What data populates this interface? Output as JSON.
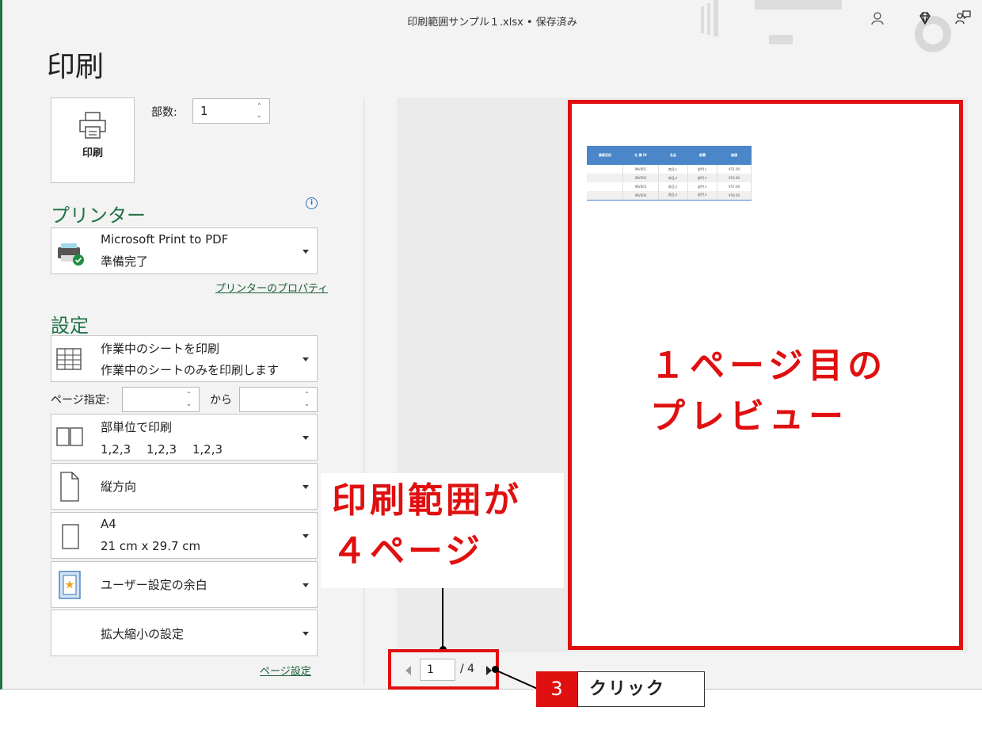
{
  "window": {
    "title": "印刷範囲サンプル１.xlsx • 保存済み"
  },
  "page": {
    "heading": "印刷"
  },
  "print_button": {
    "label": "印刷"
  },
  "copies": {
    "label": "部数:",
    "value": "1"
  },
  "printer": {
    "section_title": "プリンター",
    "name": "Microsoft Print to PDF",
    "status": "準備完了",
    "properties_link": "プリンターのプロパティ"
  },
  "settings": {
    "section_title": "設定",
    "print_what": {
      "title": "作業中のシートを印刷",
      "desc": "作業中のシートのみを印刷します"
    },
    "pages": {
      "label": "ページ指定:",
      "from_value": "",
      "to_label": "から",
      "to_value": ""
    },
    "collate": {
      "title": "部単位で印刷",
      "desc": "1,2,3　 1,2,3　 1,2,3"
    },
    "orientation": {
      "title": "縦方向"
    },
    "paper": {
      "title": "A4",
      "desc": "21 cm x 29.7 cm"
    },
    "margins": {
      "title": "ユーザー設定の余白"
    },
    "scaling": {
      "title": "拡大縮小の設定"
    },
    "page_setup_link": "ページ設定"
  },
  "preview": {
    "table": {
      "headers": [
        "貴期活用",
        "仕 業 ID",
        "名品",
        "部署",
        "価値"
      ],
      "rows": [
        [
          "",
          "INV001",
          "商品１",
          "部門１",
          "¥51.00"
        ],
        [
          "",
          "INV002",
          "商品２",
          "部門２",
          "¥53.00"
        ],
        [
          "",
          "INV003",
          "商品３",
          "部門３",
          "¥57.00"
        ],
        [
          "",
          "INV004",
          "商品４",
          "部門４",
          "¥59.00"
        ]
      ]
    }
  },
  "pager": {
    "current": "1",
    "total": "/ 4"
  },
  "annotations": {
    "preview_caption": "１ページ目の\nプレビュー",
    "range_caption": "印刷範囲が\n４ページ",
    "step_number": "3",
    "step_text": "クリック",
    "accent_color": "#e01010"
  },
  "icons": {
    "printer": "printer-icon",
    "info": "info-icon",
    "pdf_printer": "pdf-printer-icon",
    "sheet": "sheet-grid-icon",
    "collate": "collate-icon",
    "portrait": "portrait-page-icon",
    "paper": "paper-size-icon",
    "margins": "custom-margins-icon",
    "account": "person-icon",
    "premium": "diamond-icon",
    "feedback": "feedback-icon"
  }
}
